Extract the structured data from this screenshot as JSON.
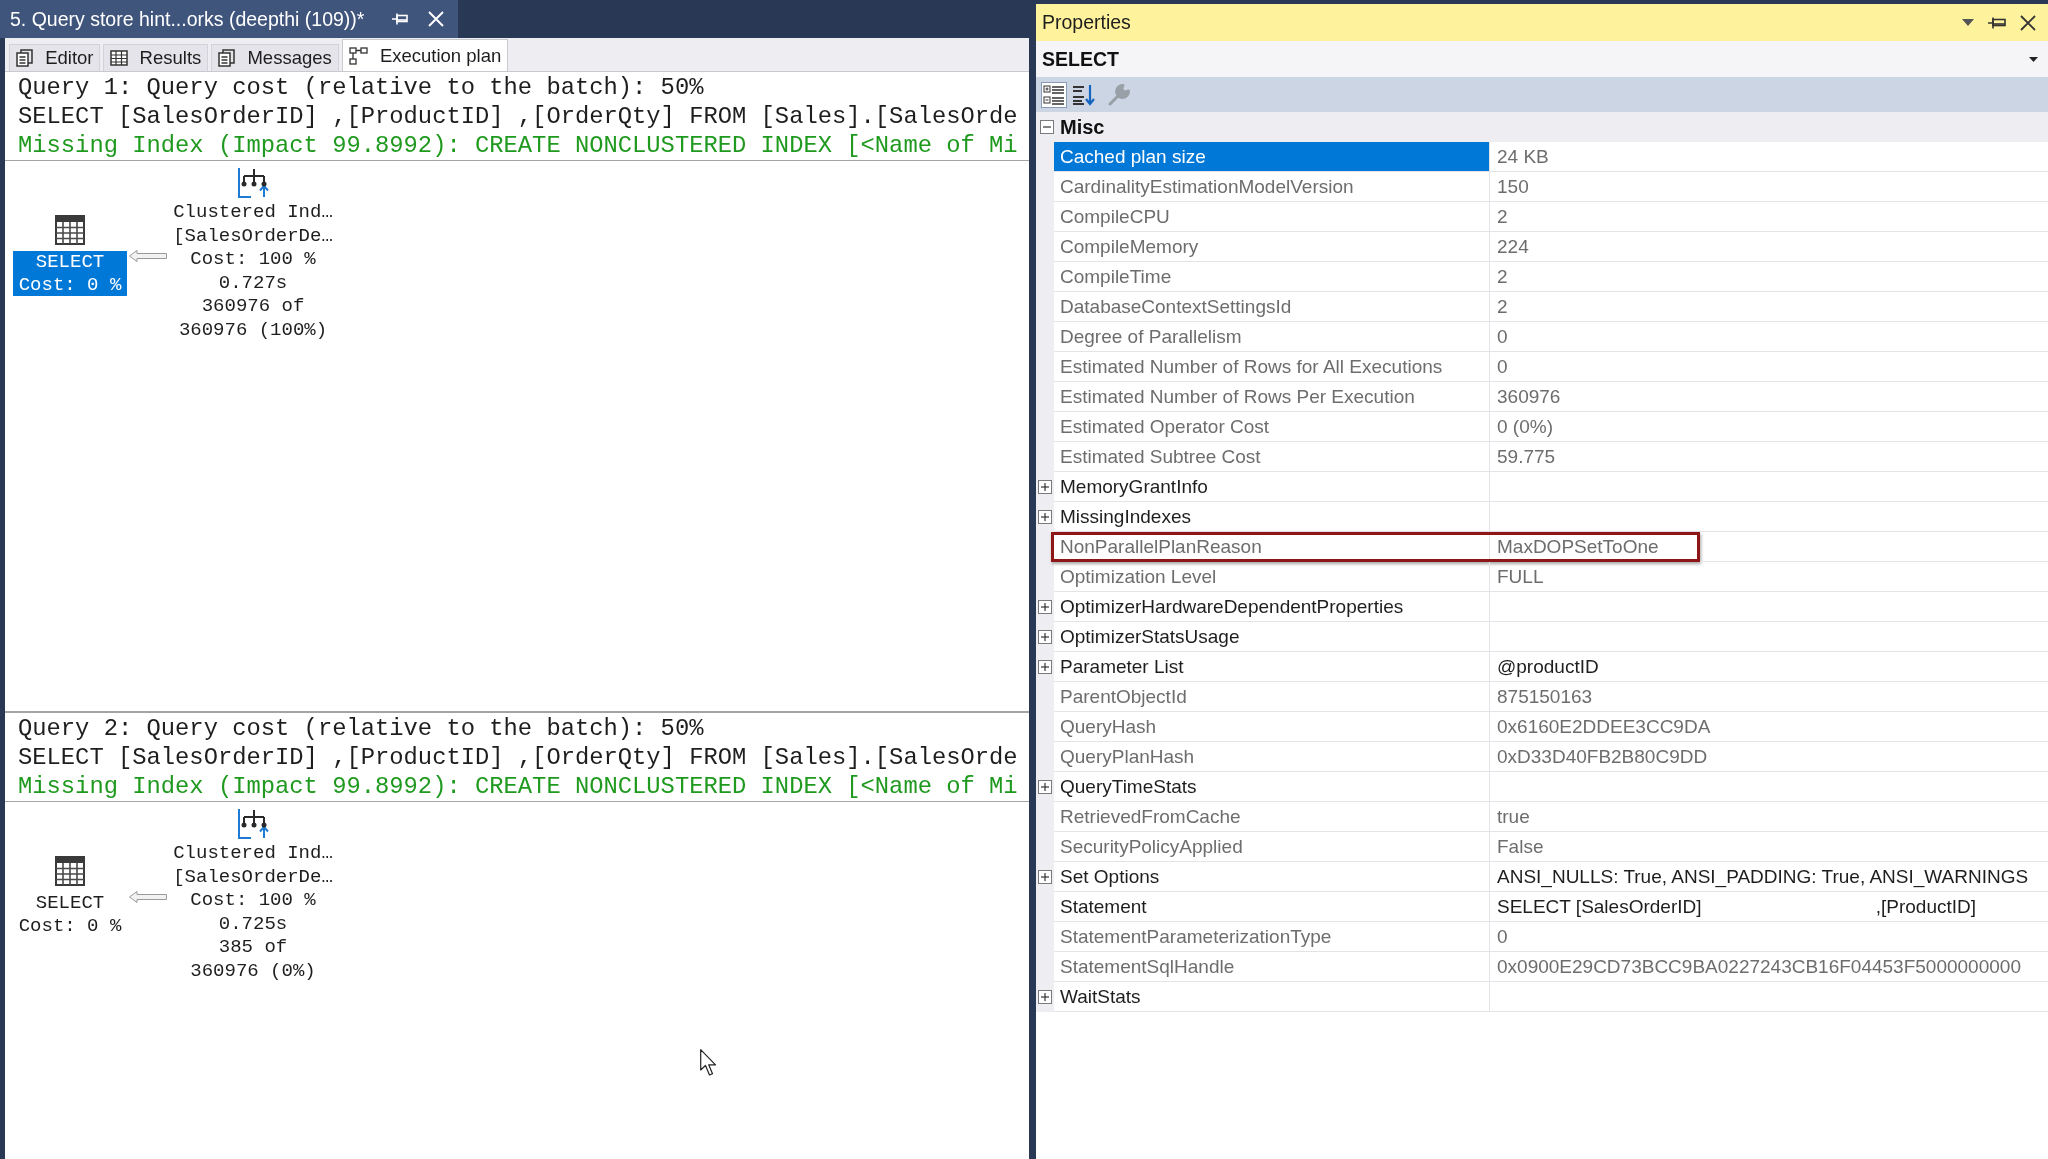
{
  "document_tab": {
    "title": "5. Query store hint...orks (deepthi (109))*"
  },
  "result_tabs": [
    {
      "kind": "editor",
      "label": "Editor",
      "selected": false
    },
    {
      "kind": "results",
      "label": "Results",
      "selected": false
    },
    {
      "kind": "messages",
      "label": "Messages",
      "selected": false
    },
    {
      "kind": "plan",
      "label": "Execution plan",
      "selected": true
    }
  ],
  "queries": [
    {
      "header": "Query 1: Query cost (relative to the batch): 50%",
      "statement": "SELECT [SalesOrderID] ,[ProductID] ,[OrderQty] FROM [Sales].[SalesOrde",
      "missing_index": "Missing Index (Impact 99.8992): CREATE NONCLUSTERED INDEX [<Name of Mi",
      "plan": [
        {
          "kind": "select",
          "selected": true,
          "lines": [
            "SELECT",
            "Cost: 0 %"
          ]
        },
        {
          "kind": "index_scan",
          "selected": false,
          "lines": [
            "Clustered Ind…",
            "[SalesOrderDe…",
            "Cost: 100 %",
            "0.727s",
            "360976 of",
            "360976 (100%)"
          ]
        }
      ]
    },
    {
      "header": "Query 2: Query cost (relative to the batch): 50%",
      "statement": "SELECT [SalesOrderID] ,[ProductID] ,[OrderQty] FROM [Sales].[SalesOrde",
      "missing_index": "Missing Index (Impact 99.8992): CREATE NONCLUSTERED INDEX [<Name of Mi",
      "plan": [
        {
          "kind": "select",
          "selected": false,
          "lines": [
            "SELECT",
            "Cost: 0 %"
          ]
        },
        {
          "kind": "index_scan",
          "selected": false,
          "lines": [
            "Clustered Ind…",
            "[SalesOrderDe…",
            "Cost: 100 %",
            "0.725s",
            "385 of",
            "360976 (0%)"
          ]
        }
      ]
    }
  ],
  "properties": {
    "title": "Properties",
    "object": "SELECT",
    "category": {
      "name": "Misc",
      "expanded": true
    },
    "rows": [
      {
        "kind": "property",
        "name": "Cached plan size",
        "value": "24 KB",
        "selected": true,
        "disabled": true,
        "highlighted": false
      },
      {
        "kind": "property",
        "name": "CardinalityEstimationModelVersion",
        "value": "150",
        "selected": false,
        "disabled": true,
        "highlighted": false
      },
      {
        "kind": "property",
        "name": "CompileCPU",
        "value": "2",
        "selected": false,
        "disabled": true,
        "highlighted": false
      },
      {
        "kind": "property",
        "name": "CompileMemory",
        "value": "224",
        "selected": false,
        "disabled": true,
        "highlighted": false
      },
      {
        "kind": "property",
        "name": "CompileTime",
        "value": "2",
        "selected": false,
        "disabled": true,
        "highlighted": false
      },
      {
        "kind": "property",
        "name": "DatabaseContextSettingsId",
        "value": "2",
        "selected": false,
        "disabled": true,
        "highlighted": false
      },
      {
        "kind": "property",
        "name": "Degree of Parallelism",
        "value": "0",
        "selected": false,
        "disabled": true,
        "highlighted": false
      },
      {
        "kind": "property",
        "name": "Estimated Number of Rows for All Executions",
        "value": "0",
        "selected": false,
        "disabled": true,
        "highlighted": false
      },
      {
        "kind": "property",
        "name": "Estimated Number of Rows Per Execution",
        "value": "360976",
        "selected": false,
        "disabled": true,
        "highlighted": false
      },
      {
        "kind": "property",
        "name": "Estimated Operator Cost",
        "value": "0 (0%)",
        "selected": false,
        "disabled": true,
        "highlighted": false
      },
      {
        "kind": "property",
        "name": "Estimated Subtree Cost",
        "value": "59.775",
        "selected": false,
        "disabled": true,
        "highlighted": false
      },
      {
        "kind": "group",
        "name": "MemoryGrantInfo",
        "expanded": false,
        "selected": false,
        "disabled": false,
        "highlighted": false
      },
      {
        "kind": "group",
        "name": "MissingIndexes",
        "expanded": false,
        "selected": false,
        "disabled": false,
        "highlighted": false
      },
      {
        "kind": "property",
        "name": "NonParallelPlanReason",
        "value": "MaxDOPSetToOne",
        "selected": false,
        "disabled": true,
        "highlighted": true
      },
      {
        "kind": "property",
        "name": "Optimization Level",
        "value": "FULL",
        "selected": false,
        "disabled": true,
        "highlighted": false
      },
      {
        "kind": "group",
        "name": "OptimizerHardwareDependentProperties",
        "expanded": false,
        "selected": false,
        "disabled": false,
        "highlighted": false
      },
      {
        "kind": "group",
        "name": "OptimizerStatsUsage",
        "expanded": false,
        "selected": false,
        "disabled": false,
        "highlighted": false
      },
      {
        "kind": "group",
        "name": "Parameter List",
        "value": "@productID",
        "expanded": false,
        "selected": false,
        "disabled": false,
        "highlighted": false
      },
      {
        "kind": "property",
        "name": "ParentObjectId",
        "value": "875150163",
        "selected": false,
        "disabled": true,
        "highlighted": false
      },
      {
        "kind": "property",
        "name": "QueryHash",
        "value": "0x6160E2DDEE3CC9DA",
        "selected": false,
        "disabled": true,
        "highlighted": false
      },
      {
        "kind": "property",
        "name": "QueryPlanHash",
        "value": "0xD33D40FB2B80C9DD",
        "selected": false,
        "disabled": true,
        "highlighted": false
      },
      {
        "kind": "group",
        "name": "QueryTimeStats",
        "expanded": false,
        "selected": false,
        "disabled": false,
        "highlighted": false
      },
      {
        "kind": "property",
        "name": "RetrievedFromCache",
        "value": "true",
        "selected": false,
        "disabled": true,
        "highlighted": false
      },
      {
        "kind": "property",
        "name": "SecurityPolicyApplied",
        "value": "False",
        "selected": false,
        "disabled": true,
        "highlighted": false
      },
      {
        "kind": "group",
        "name": "Set Options",
        "value": "ANSI_NULLS: True, ANSI_PADDING: True, ANSI_WARNINGS",
        "expanded": false,
        "selected": false,
        "disabled": false,
        "highlighted": false
      },
      {
        "kind": "property",
        "name": "Statement",
        "value": "SELECT [SalesOrderID]                                 ,[ProductID]",
        "selected": false,
        "disabled": false,
        "highlighted": false
      },
      {
        "kind": "property",
        "name": "StatementParameterizationType",
        "value": "0",
        "selected": false,
        "disabled": true,
        "highlighted": false
      },
      {
        "kind": "property",
        "name": "StatementSqlHandle",
        "value": "0x0900E29CD73BCC9BA0227243CB16F04453F5000000000",
        "selected": false,
        "disabled": true,
        "highlighted": false
      },
      {
        "kind": "group",
        "name": "WaitStats",
        "expanded": false,
        "selected": false,
        "disabled": false,
        "highlighted": false
      }
    ]
  }
}
